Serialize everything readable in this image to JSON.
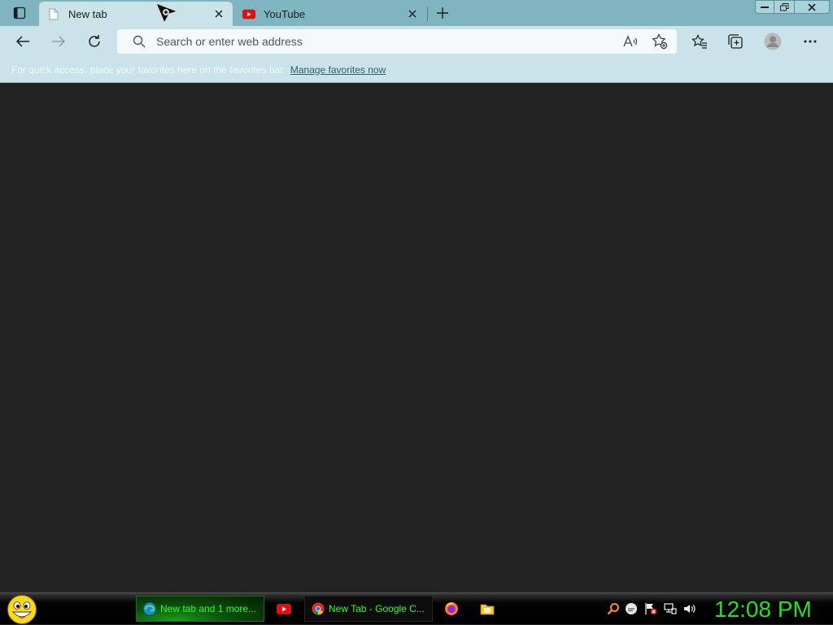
{
  "tabs": [
    {
      "title": "New tab",
      "icon": "page-icon",
      "active": true
    },
    {
      "title": "YouTube",
      "icon": "youtube-icon",
      "active": false
    }
  ],
  "address_bar": {
    "placeholder": "Search or enter web address",
    "value": ""
  },
  "favorites_bar": {
    "message": "For quick access, place your favorites here on the favorites bar.",
    "link": "Manage favorites now"
  },
  "taskbar": {
    "items": [
      {
        "label": "New tab and 1 more...",
        "icon": "edge-icon"
      },
      {
        "label": "New Tab - Google C...",
        "icon": "chrome-icon"
      }
    ],
    "clock": "12:08 PM"
  },
  "colors": {
    "tabstrip": "#7fb5c0",
    "toolbar": "#c9e3e8",
    "page": "#232323",
    "clock": "#23e023"
  }
}
